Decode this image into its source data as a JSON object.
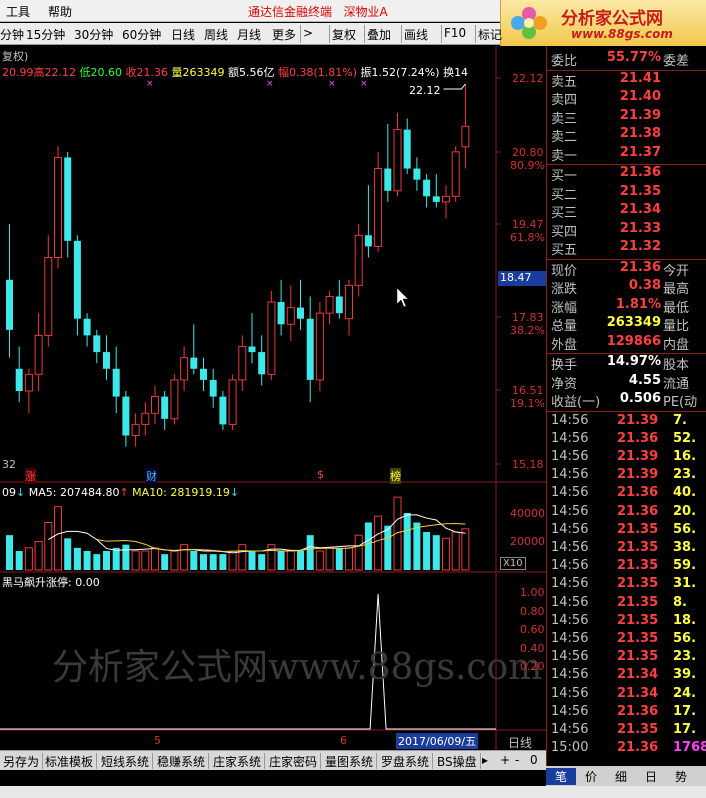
{
  "menu": {
    "tools": "工具",
    "help": "帮助",
    "title": "通达信金融终端",
    "security": "深物业A"
  },
  "logo": {
    "name": "分析家公式网",
    "url": "www.88gs.com"
  },
  "toolbar": {
    "items": [
      "分钟",
      "15分钟",
      "30分钟",
      "60分钟",
      "日线",
      "周线",
      "月线",
      "更多",
      ">",
      "复权",
      "叠加",
      "画线",
      "F10",
      "标记"
    ]
  },
  "chart_header": {
    "adj": "复权)",
    "open": "20.99",
    "high_label": "高",
    "high": "22.12",
    "low_label": "低",
    "low": "20.60",
    "close_label": "收",
    "close": "21.36",
    "vol_label": "量",
    "vol": "263349",
    "amt_label": "额",
    "amt": "5.56亿",
    "chg_label": "幅",
    "chg": "0.38(1.81%)",
    "amp_label": "振",
    "amp": "1.52(7.24%)",
    "turn_label": "换",
    "turn": "14"
  },
  "price_axis": {
    "labels": [
      {
        "p": "22.12",
        "pct": ""
      },
      {
        "p": "20.80",
        "pct": "80.9%"
      },
      {
        "p": "19.47",
        "pct": "61.8%"
      },
      {
        "p": "17.83",
        "pct": "38.2%"
      },
      {
        "p": "16.51",
        "pct": "19.1%"
      },
      {
        "p": "15.18",
        "pct": ""
      }
    ],
    "current_box": "18.47",
    "high_annotation": "22.12",
    "left_edge": "32"
  },
  "markers": {
    "zhang": "涨",
    "cai": "财",
    "s": "$",
    "bang": "榜"
  },
  "ma_header": {
    "prefix": "09",
    "ma5_label": "MA5:",
    "ma5": "207484.80",
    "ma10_label": "MA10:",
    "ma10": "281919.19"
  },
  "volume_axis": {
    "labels": [
      "40000",
      "20000"
    ],
    "unit": "X10"
  },
  "indicator": {
    "label": "黑马飙升涨停: 0.00",
    "axis": [
      "1.00",
      "0.80",
      "0.60",
      "0.40",
      "0.20"
    ]
  },
  "watermark": "分析家公式网www.88gs.com",
  "date_axis": {
    "m5": "5",
    "m6": "6",
    "date": "2017/06/09/五",
    "period": "日线"
  },
  "chart_data": {
    "type": "candlestick",
    "series": [
      {
        "o": 18.6,
        "h": 19.6,
        "l": 17.2,
        "c": 17.7
      },
      {
        "o": 17.0,
        "h": 17.4,
        "l": 16.4,
        "c": 16.6
      },
      {
        "o": 16.6,
        "h": 17.0,
        "l": 16.2,
        "c": 16.9
      },
      {
        "o": 16.9,
        "h": 18.0,
        "l": 16.6,
        "c": 17.6
      },
      {
        "o": 17.6,
        "h": 19.4,
        "l": 17.4,
        "c": 19.0
      },
      {
        "o": 19.0,
        "h": 21.0,
        "l": 18.8,
        "c": 20.8
      },
      {
        "o": 20.8,
        "h": 20.9,
        "l": 19.0,
        "c": 19.3
      },
      {
        "o": 19.3,
        "h": 19.4,
        "l": 17.6,
        "c": 17.9
      },
      {
        "o": 17.9,
        "h": 18.0,
        "l": 17.4,
        "c": 17.6
      },
      {
        "o": 17.6,
        "h": 17.7,
        "l": 17.1,
        "c": 17.3
      },
      {
        "o": 17.3,
        "h": 17.6,
        "l": 16.8,
        "c": 17.0
      },
      {
        "o": 17.0,
        "h": 17.4,
        "l": 16.2,
        "c": 16.5
      },
      {
        "o": 16.5,
        "h": 16.6,
        "l": 15.6,
        "c": 15.8
      },
      {
        "o": 15.8,
        "h": 16.2,
        "l": 15.6,
        "c": 16.0
      },
      {
        "o": 16.0,
        "h": 16.4,
        "l": 15.8,
        "c": 16.2
      },
      {
        "o": 16.2,
        "h": 16.7,
        "l": 16.0,
        "c": 16.5
      },
      {
        "o": 16.5,
        "h": 16.6,
        "l": 15.9,
        "c": 16.1
      },
      {
        "o": 16.1,
        "h": 16.9,
        "l": 16.0,
        "c": 16.8
      },
      {
        "o": 16.8,
        "h": 17.4,
        "l": 16.6,
        "c": 17.2
      },
      {
        "o": 17.2,
        "h": 17.8,
        "l": 16.9,
        "c": 17.0
      },
      {
        "o": 17.0,
        "h": 17.2,
        "l": 16.6,
        "c": 16.8
      },
      {
        "o": 16.8,
        "h": 17.0,
        "l": 16.3,
        "c": 16.5
      },
      {
        "o": 16.5,
        "h": 16.6,
        "l": 15.9,
        "c": 16.0
      },
      {
        "o": 16.0,
        "h": 16.9,
        "l": 15.9,
        "c": 16.8
      },
      {
        "o": 16.8,
        "h": 17.6,
        "l": 16.6,
        "c": 17.4
      },
      {
        "o": 17.4,
        "h": 18.0,
        "l": 17.1,
        "c": 17.3
      },
      {
        "o": 17.3,
        "h": 17.6,
        "l": 16.7,
        "c": 16.9
      },
      {
        "o": 16.9,
        "h": 18.4,
        "l": 16.8,
        "c": 18.2
      },
      {
        "o": 18.2,
        "h": 18.6,
        "l": 17.6,
        "c": 17.8
      },
      {
        "o": 17.8,
        "h": 18.5,
        "l": 17.5,
        "c": 18.1
      },
      {
        "o": 18.1,
        "h": 18.6,
        "l": 17.7,
        "c": 17.9
      },
      {
        "o": 17.9,
        "h": 18.3,
        "l": 16.4,
        "c": 16.8
      },
      {
        "o": 16.8,
        "h": 18.2,
        "l": 16.6,
        "c": 18.0
      },
      {
        "o": 18.0,
        "h": 18.4,
        "l": 17.8,
        "c": 18.3
      },
      {
        "o": 18.3,
        "h": 18.6,
        "l": 17.9,
        "c": 18.0
      },
      {
        "o": 17.9,
        "h": 18.6,
        "l": 17.6,
        "c": 18.5
      },
      {
        "o": 18.5,
        "h": 19.6,
        "l": 18.3,
        "c": 19.4
      },
      {
        "o": 19.4,
        "h": 20.3,
        "l": 19.0,
        "c": 19.2
      },
      {
        "o": 19.2,
        "h": 20.9,
        "l": 19.1,
        "c": 20.6
      },
      {
        "o": 20.6,
        "h": 21.4,
        "l": 20.0,
        "c": 20.2
      },
      {
        "o": 20.2,
        "h": 21.6,
        "l": 20.1,
        "c": 21.3
      },
      {
        "o": 21.3,
        "h": 21.5,
        "l": 20.5,
        "c": 20.6
      },
      {
        "o": 20.6,
        "h": 20.8,
        "l": 20.2,
        "c": 20.4
      },
      {
        "o": 20.4,
        "h": 20.5,
        "l": 19.9,
        "c": 20.1
      },
      {
        "o": 20.1,
        "h": 20.5,
        "l": 19.9,
        "c": 20.0
      },
      {
        "o": 20.0,
        "h": 20.3,
        "l": 19.7,
        "c": 20.1
      },
      {
        "o": 20.1,
        "h": 21.0,
        "l": 20.0,
        "c": 20.9
      },
      {
        "o": 20.99,
        "h": 22.12,
        "l": 20.6,
        "c": 21.36
      }
    ],
    "volume": [
      22,
      12,
      14,
      18,
      30,
      40,
      20,
      14,
      12,
      10,
      12,
      14,
      16,
      12,
      12,
      14,
      10,
      12,
      16,
      12,
      10,
      10,
      10,
      12,
      16,
      12,
      10,
      16,
      12,
      12,
      12,
      22,
      12,
      14,
      14,
      14,
      22,
      30,
      34,
      28,
      46,
      36,
      30,
      24,
      22,
      20,
      24,
      26
    ],
    "indicator_values_note": "single spike at bar 38",
    "spike_index": 38,
    "spike_value": 1.0
  },
  "quote_panel": {
    "weibi": {
      "label": "委比",
      "value": "55.77%",
      "side": "委差"
    },
    "asks": [
      {
        "label": "卖五",
        "price": "21.41"
      },
      {
        "label": "卖四",
        "price": "21.40"
      },
      {
        "label": "卖三",
        "price": "21.39"
      },
      {
        "label": "卖二",
        "price": "21.38"
      },
      {
        "label": "卖一",
        "price": "21.37"
      }
    ],
    "bids": [
      {
        "label": "买一",
        "price": "21.36"
      },
      {
        "label": "买二",
        "price": "21.35"
      },
      {
        "label": "买三",
        "price": "21.34"
      },
      {
        "label": "买四",
        "price": "21.33"
      },
      {
        "label": "买五",
        "price": "21.32"
      }
    ],
    "stats": [
      {
        "label": "现价",
        "value": "21.36",
        "side": "今开",
        "cls": "red"
      },
      {
        "label": "涨跌",
        "value": "0.38",
        "side": "最高",
        "cls": "red"
      },
      {
        "label": "涨幅",
        "value": "1.81%",
        "side": "最低",
        "cls": "red"
      },
      {
        "label": "总量",
        "value": "263349",
        "side": "量比",
        "cls": "yel"
      },
      {
        "label": "外盘",
        "value": "129866",
        "side": "内盘",
        "cls": "red"
      }
    ],
    "stats2": [
      {
        "label": "换手",
        "value": "14.97%",
        "side": "股本",
        "cls": "wht"
      },
      {
        "label": "净资",
        "value": "4.55",
        "side": "流通",
        "cls": "wht"
      },
      {
        "label": "收益(一)",
        "value": "0.506",
        "side": "PE(动",
        "cls": "wht"
      }
    ],
    "ticks": [
      {
        "t": "14:56",
        "p": "21.39",
        "v": "7.",
        "pc": "red",
        "vc": "yel"
      },
      {
        "t": "14:56",
        "p": "21.36",
        "v": "52.",
        "pc": "red",
        "vc": "yel"
      },
      {
        "t": "14:56",
        "p": "21.39",
        "v": "16.",
        "pc": "red",
        "vc": "yel"
      },
      {
        "t": "14:56",
        "p": "21.39",
        "v": "23.",
        "pc": "red",
        "vc": "yel"
      },
      {
        "t": "14:56",
        "p": "21.36",
        "v": "40.",
        "pc": "red",
        "vc": "yel"
      },
      {
        "t": "14:56",
        "p": "21.36",
        "v": "20.",
        "pc": "red",
        "vc": "yel"
      },
      {
        "t": "14:56",
        "p": "21.35",
        "v": "56.",
        "pc": "red",
        "vc": "yel"
      },
      {
        "t": "14:56",
        "p": "21.35",
        "v": "38.",
        "pc": "red",
        "vc": "yel"
      },
      {
        "t": "14:56",
        "p": "21.35",
        "v": "59.",
        "pc": "red",
        "vc": "yel"
      },
      {
        "t": "14:56",
        "p": "21.35",
        "v": "31.",
        "pc": "red",
        "vc": "yel"
      },
      {
        "t": "14:56",
        "p": "21.35",
        "v": "8.",
        "pc": "red",
        "vc": "yel"
      },
      {
        "t": "14:56",
        "p": "21.35",
        "v": "18.",
        "pc": "red",
        "vc": "yel"
      },
      {
        "t": "14:56",
        "p": "21.35",
        "v": "56.",
        "pc": "red",
        "vc": "yel"
      },
      {
        "t": "14:56",
        "p": "21.35",
        "v": "23.",
        "pc": "red",
        "vc": "yel"
      },
      {
        "t": "14:56",
        "p": "21.34",
        "v": "39.",
        "pc": "red",
        "vc": "yel"
      },
      {
        "t": "14:56",
        "p": "21.34",
        "v": "24.",
        "pc": "red",
        "vc": "yel"
      },
      {
        "t": "14:56",
        "p": "21.36",
        "v": "17.",
        "pc": "red",
        "vc": "yel"
      },
      {
        "t": "14:56",
        "p": "21.35",
        "v": "17.",
        "pc": "red",
        "vc": "yel"
      },
      {
        "t": "15:00",
        "p": "21.36",
        "v": "1768.",
        "pc": "red",
        "vc": "mag"
      }
    ]
  },
  "bottom_tabs": [
    "另存为",
    "标准模板",
    "短线系统",
    "稳赚系统",
    "庄家系统",
    "庄家密码",
    "量图系统",
    "罗盘系统",
    "BS操盘"
  ],
  "bottom_controls": [
    "+",
    "-",
    "0"
  ],
  "rp_tabs": [
    "笔",
    "价",
    "细",
    "日",
    "势"
  ],
  "colors": {
    "up": "#e83a3a",
    "down": "#3ee8e8",
    "ma5": "#ffffff",
    "ma10": "#f0d040",
    "panel_line": "#8a1c1c"
  }
}
